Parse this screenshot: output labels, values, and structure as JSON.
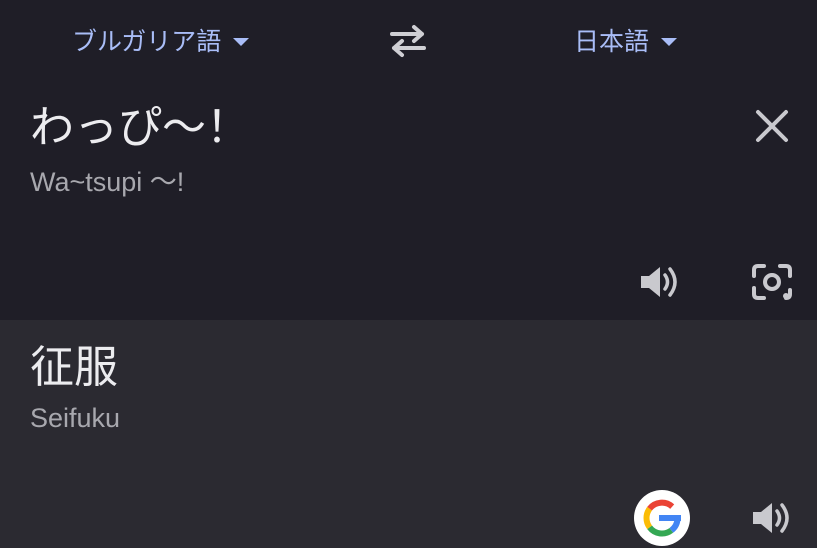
{
  "header": {
    "source_language": "ブルガリア語",
    "target_language": "日本語",
    "swap_icon": "swap-arrows-icon"
  },
  "source": {
    "text": "わっぴ〜！",
    "transliteration": "Wa~tsupi 〜!",
    "icons": [
      "close-icon",
      "speaker-icon",
      "camera-lens-icon"
    ]
  },
  "result": {
    "text": "征服",
    "transliteration": "Seifuku",
    "icons": [
      "google-icon",
      "speaker-icon"
    ]
  },
  "colors": {
    "top_background": "#1f1e27",
    "bottom_background": "#2b2a31",
    "accent": "#a9bdf7",
    "text_primary": "#ececef",
    "text_secondary": "#a8a8ae",
    "icon": "#c9c9ce"
  }
}
